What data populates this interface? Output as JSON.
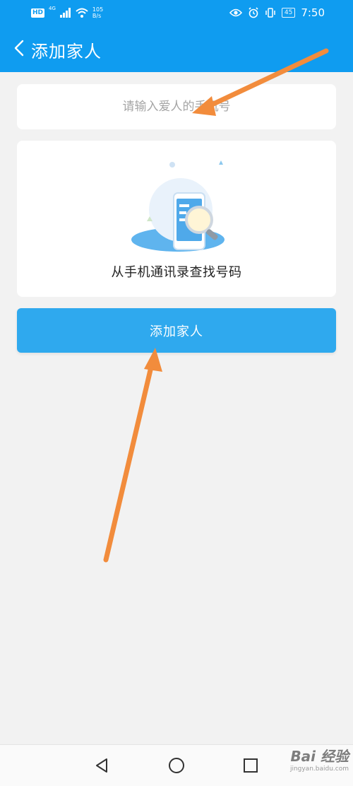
{
  "status_bar": {
    "hd": "HD",
    "network": "4G",
    "speed_value": "105",
    "speed_unit": "B/s",
    "battery": "45",
    "time": "7:50"
  },
  "header": {
    "title": "添加家人"
  },
  "phone_input": {
    "placeholder": "请输入爱人的手机号",
    "value": ""
  },
  "contacts": {
    "label": "从手机通讯录查找号码"
  },
  "primary_button": {
    "label": "添加家人"
  },
  "watermark": {
    "brand": "Bai 经验",
    "url": "jingyan.baidu.com"
  },
  "colors": {
    "header_blue": "#0f9cf0",
    "button_blue": "#2fa9ee",
    "annotation_arrow": "#f28c3c",
    "background": "#f2f2f2"
  },
  "icons": {
    "back": "chevron-left-icon",
    "eye": "eye-icon",
    "alarm": "alarm-icon",
    "vibrate": "vibrate-icon",
    "nav_back": "triangle-back-icon",
    "nav_home": "circle-home-icon",
    "nav_recent": "square-recent-icon"
  }
}
